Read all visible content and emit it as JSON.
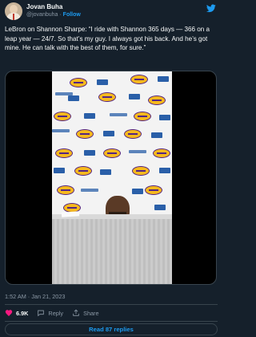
{
  "author": {
    "name": "Jovan Buha",
    "handle": "@jovanbuha",
    "separator": "·",
    "follow_label": "Follow"
  },
  "tweet": {
    "text": "LeBron on Shannon Sharpe: “I ride with Shannon 365 days — 366 on a leap year — 24/7. So that’s my guy. I always got his back. And he’s got mine. He can talk with the best of them, for sure.”"
  },
  "media": {
    "type": "video",
    "backdrop_logos": [
      "LAKERS",
      "UCLA Health"
    ]
  },
  "meta": {
    "timestamp": "1:52 AM · Jan 21, 2023"
  },
  "actions": {
    "like_count": "6.9K",
    "reply_label": "Reply",
    "share_label": "Share"
  },
  "replies": {
    "label": "Read 87 replies"
  },
  "colors": {
    "background": "#15202b",
    "accent": "#1d9bf0",
    "like": "#f91880",
    "muted": "#8b98a5",
    "border": "#38444d"
  },
  "icons": {
    "logo": "twitter-bird-icon",
    "like": "heart-icon",
    "reply": "reply-bubble-icon",
    "share": "share-upload-icon"
  }
}
